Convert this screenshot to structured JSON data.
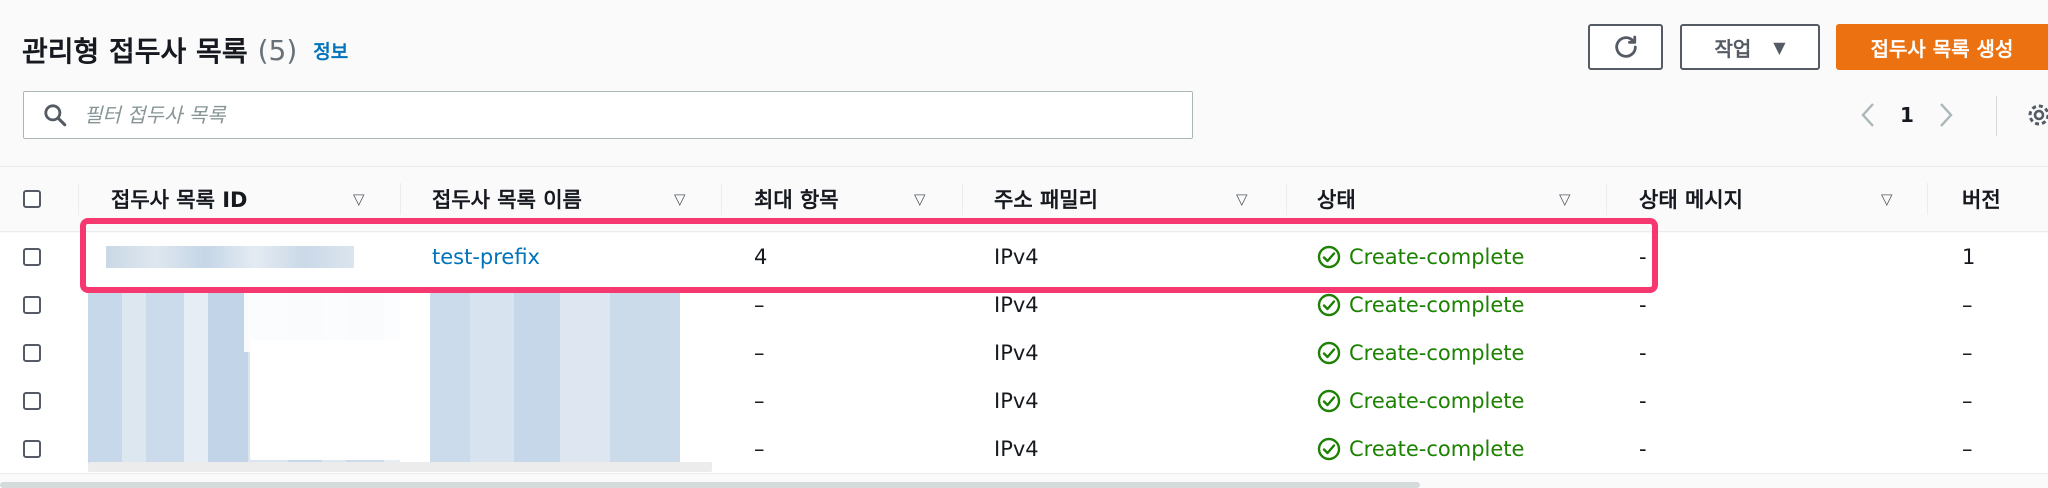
{
  "header": {
    "title": "관리형 접두사 목록",
    "count": "(5)",
    "info_link": "정보",
    "actions_label": "작업",
    "create_label": "접두사 목록 생성"
  },
  "search": {
    "placeholder": "필터 접두사 목록"
  },
  "pagination": {
    "current_page": "1"
  },
  "table": {
    "columns": [
      "접두사 목록 ID",
      "접두사 목록 이름",
      "최대 항목",
      "주소 패밀리",
      "상태",
      "상태 메시지",
      "버전"
    ],
    "rows": [
      {
        "id": "",
        "name": "test-prefix",
        "max_entries": "4",
        "family": "IPv4",
        "status": "Create-complete",
        "status_message": "-",
        "version": "1"
      },
      {
        "id": "",
        "name": "",
        "max_entries": "–",
        "family": "IPv4",
        "status": "Create-complete",
        "status_message": "-",
        "version": "–"
      },
      {
        "id": "",
        "name": "",
        "max_entries": "–",
        "family": "IPv4",
        "status": "Create-complete",
        "status_message": "-",
        "version": "–"
      },
      {
        "id": "",
        "name": "",
        "max_entries": "–",
        "family": "IPv4",
        "status": "Create-complete",
        "status_message": "-",
        "version": "–"
      },
      {
        "id": "",
        "name": "",
        "max_entries": "–",
        "family": "IPv4",
        "status": "Create-complete",
        "status_message": "-",
        "version": "–"
      }
    ]
  },
  "colors": {
    "accent": "#ec7211",
    "link": "#0073bb",
    "success": "#1d8102",
    "highlight": "#f5386f"
  }
}
